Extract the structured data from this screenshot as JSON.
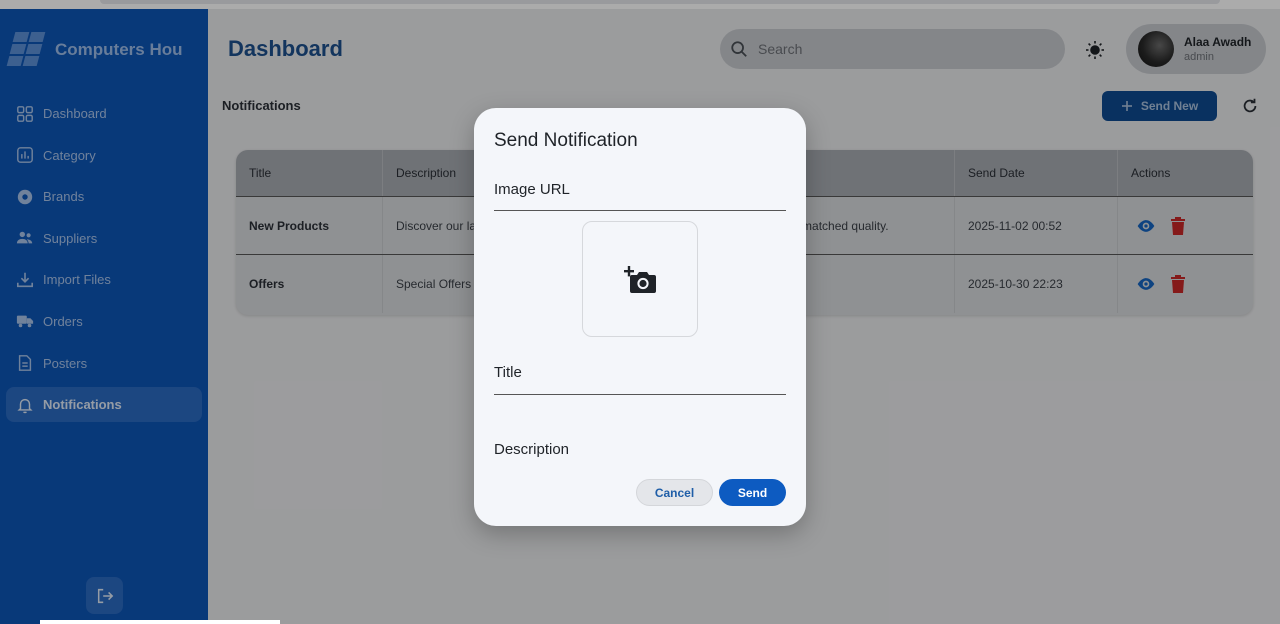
{
  "brand": {
    "name": "Computers Hou"
  },
  "sidebar": {
    "items": [
      {
        "label": "Dashboard",
        "icon": "grid-icon"
      },
      {
        "label": "Category",
        "icon": "chart-icon"
      },
      {
        "label": "Brands",
        "icon": "badge-icon"
      },
      {
        "label": "Suppliers",
        "icon": "people-icon"
      },
      {
        "label": "Import Files",
        "icon": "download-icon"
      },
      {
        "label": "Orders",
        "icon": "truck-icon"
      },
      {
        "label": "Posters",
        "icon": "document-icon"
      },
      {
        "label": "Notifications",
        "icon": "bell-icon",
        "active": true
      }
    ]
  },
  "header": {
    "title": "Dashboard",
    "search_placeholder": "Search",
    "user": {
      "name": "Alaa Awadh",
      "role": "admin"
    }
  },
  "section": {
    "title": "Notifications",
    "send_new_label": "Send New"
  },
  "table": {
    "columns": [
      "Title",
      "Description",
      "Send Date",
      "Actions"
    ],
    "rows": [
      {
        "title": "New Products",
        "description": "Discover our la",
        "description_tail": "matched quality.",
        "send_date": "2025-11-02 00:52"
      },
      {
        "title": "Offers",
        "description": "Special Offers",
        "description_tail": "",
        "send_date": "2025-10-30 22:23"
      }
    ]
  },
  "dialog": {
    "title": "Send Notification",
    "image_url_label": "Image URL",
    "title_label": "Title",
    "description_label": "Description",
    "cancel_label": "Cancel",
    "send_label": "Send"
  },
  "colors": {
    "sidebar": "#0d55b5",
    "primary": "#0d5bc1",
    "delete": "#c62828",
    "view": "#1565c0"
  }
}
